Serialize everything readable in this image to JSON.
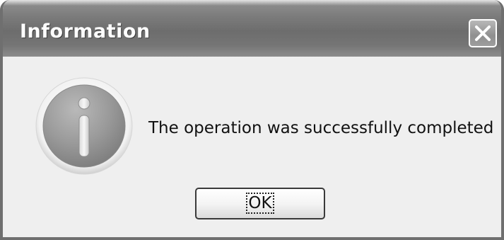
{
  "dialog": {
    "title": "Information",
    "message": "The operation was successfully completed",
    "ok_label": "OK",
    "icon": "information-icon"
  },
  "titlebar": {
    "close_icon": "close-icon"
  },
  "colors": {
    "dialog_background": "#efefef",
    "titlebar": "#757575",
    "title_text": "#ffffff",
    "message_text": "#111111"
  }
}
